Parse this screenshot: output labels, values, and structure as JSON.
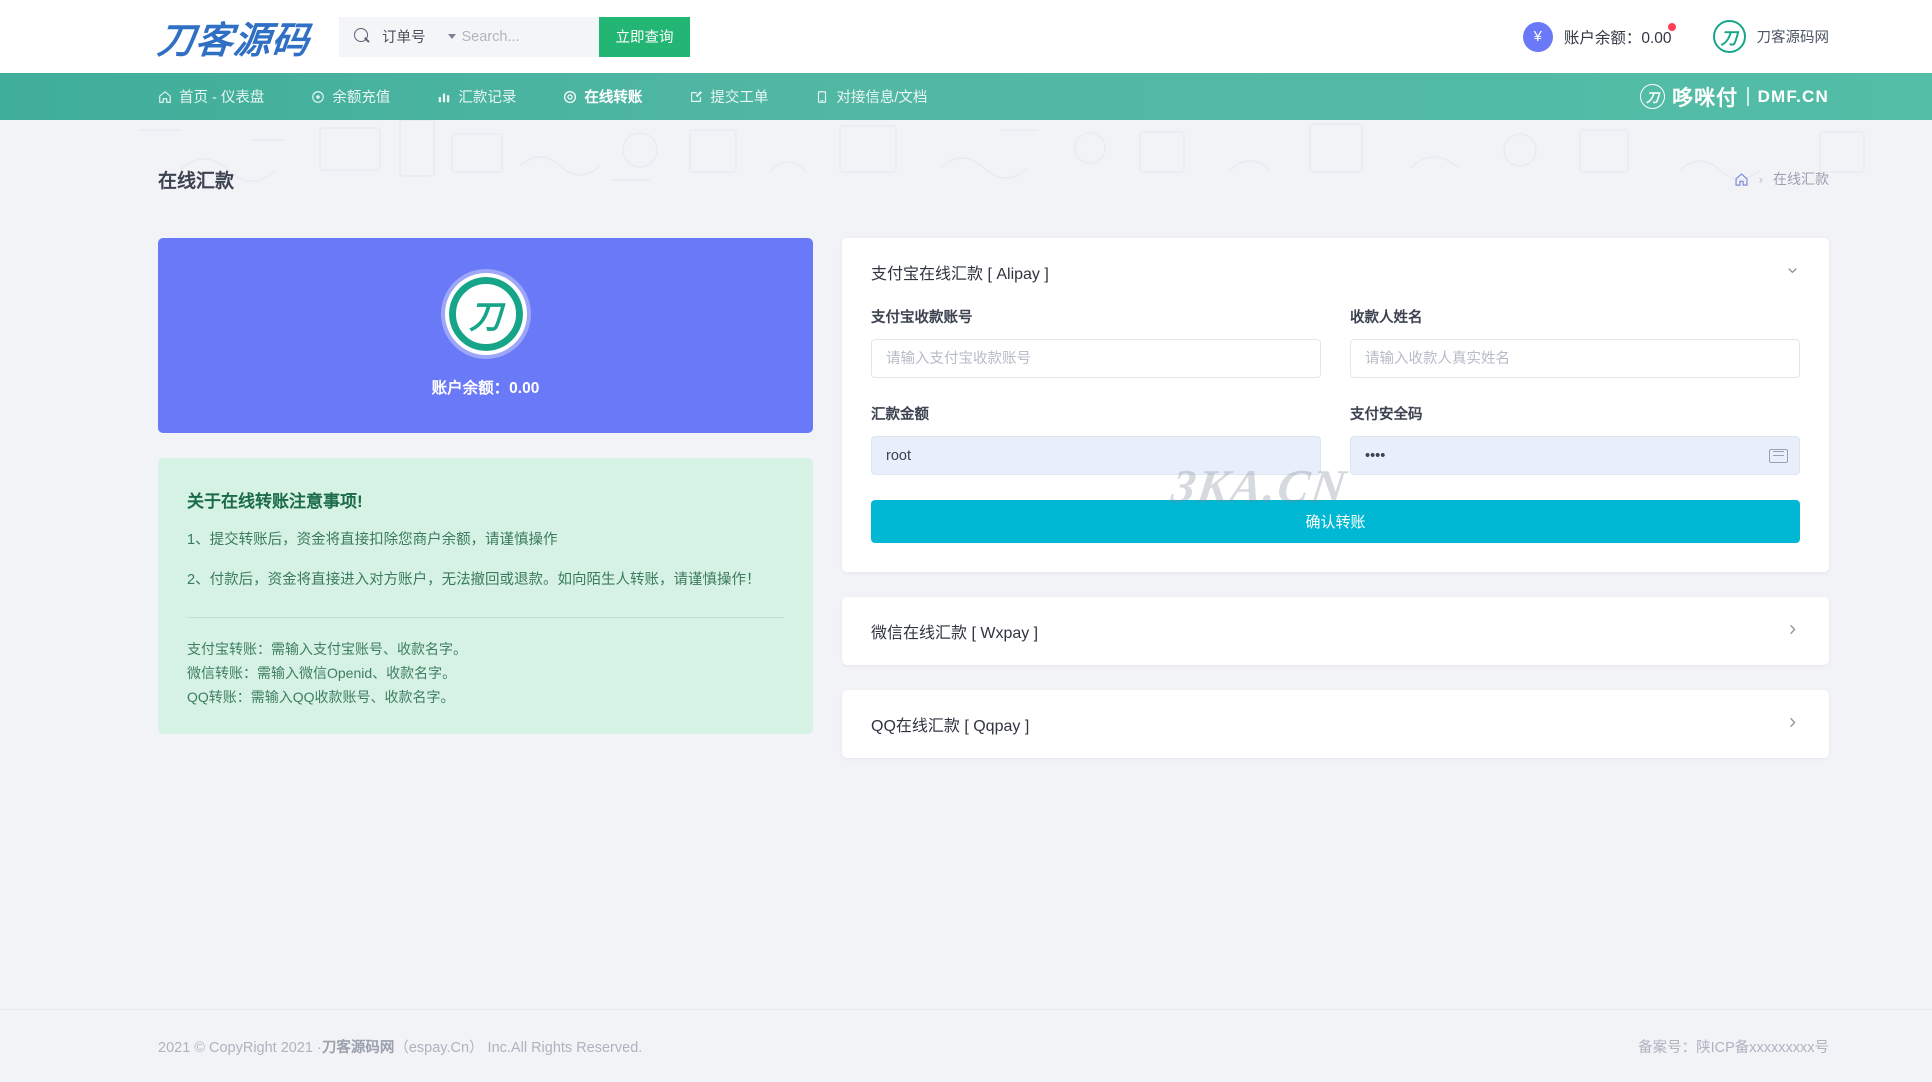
{
  "header": {
    "brand": "刀客源码",
    "search": {
      "type_label": "订单号",
      "placeholder": "Search...",
      "value": "",
      "button_label": "立即查询"
    },
    "balance": {
      "currency_symbol": "¥",
      "label": "账户余额：",
      "amount": "0.00"
    },
    "user": {
      "avatar_glyph": "刀",
      "name": "刀客源码网"
    }
  },
  "nav": {
    "items": [
      {
        "label": "首页 - 仪表盘",
        "icon": "home-icon",
        "active": false
      },
      {
        "label": "余额充值",
        "icon": "location-icon",
        "active": false
      },
      {
        "label": "汇款记录",
        "icon": "bar-chart-icon",
        "active": false
      },
      {
        "label": "在线转账",
        "icon": "target-icon",
        "active": true
      },
      {
        "label": "提交工单",
        "icon": "edit-square-icon",
        "active": false
      },
      {
        "label": "对接信息/文档",
        "icon": "book-icon",
        "active": false
      }
    ],
    "right_logo": {
      "mark_glyph": "刀",
      "cn": "哆咪付",
      "en": "DMF.CN"
    }
  },
  "page": {
    "title": "在线汇款",
    "breadcrumb": {
      "home_icon": "home-icon",
      "separator": "›",
      "current": "在线汇款"
    },
    "watermark": "3KA.CN"
  },
  "balance_card": {
    "logo_glyph": "刀",
    "label": "账户余额：",
    "amount": "0.00"
  },
  "notice": {
    "title": "关于在线转账注意事项!",
    "lines": [
      "1、提交转账后，资金将直接扣除您商户余额，请谨慎操作",
      "2、付款后，资金将直接进入对方账户，无法撤回或退款。如向陌生人转账，请谨慎操作！"
    ],
    "tips": [
      "支付宝转账：需输入支付宝账号、收款名字。",
      "微信转账：需输入微信Openid、收款名字。",
      "QQ转账：需输入QQ收款账号、收款名字。"
    ]
  },
  "panels": [
    {
      "title": "支付宝在线汇款 [ Alipay ]",
      "expanded": true,
      "chevron": "chevron-down-icon",
      "fields": [
        {
          "label": "支付宝收款账号",
          "placeholder": "请输入支付宝收款账号",
          "value": "",
          "type": "text"
        },
        {
          "label": "收款人姓名",
          "placeholder": "请输入收款人真实姓名",
          "value": "",
          "type": "text"
        },
        {
          "label": "汇款金额",
          "placeholder": "",
          "value": "root",
          "type": "text"
        },
        {
          "label": "支付安全码",
          "placeholder": "",
          "value": "••••",
          "type": "password"
        }
      ],
      "submit_label": "确认转账"
    },
    {
      "title": "微信在线汇款 [ Wxpay ]",
      "expanded": false,
      "chevron": "chevron-right-icon"
    },
    {
      "title": "QQ在线汇款 [ Qqpay ]",
      "expanded": false,
      "chevron": "chevron-right-icon"
    }
  ],
  "footer": {
    "copyright_prefix": "2021 © CopyRight 2021 ·",
    "copyright_brand": "刀客源码网",
    "copyright_suffix": "（espay.Cn） Inc.All Rights Reserved.",
    "icp": "备案号：陕ICP备xxxxxxxxx号"
  },
  "colors": {
    "nav_green": "#52b8a4",
    "search_button_green": "#22b573",
    "purple_card": "#6979f8",
    "notice_green_bg": "#d6f2e4",
    "submit_cyan": "#00b8d4",
    "filled_input_bg": "#e8effb"
  }
}
